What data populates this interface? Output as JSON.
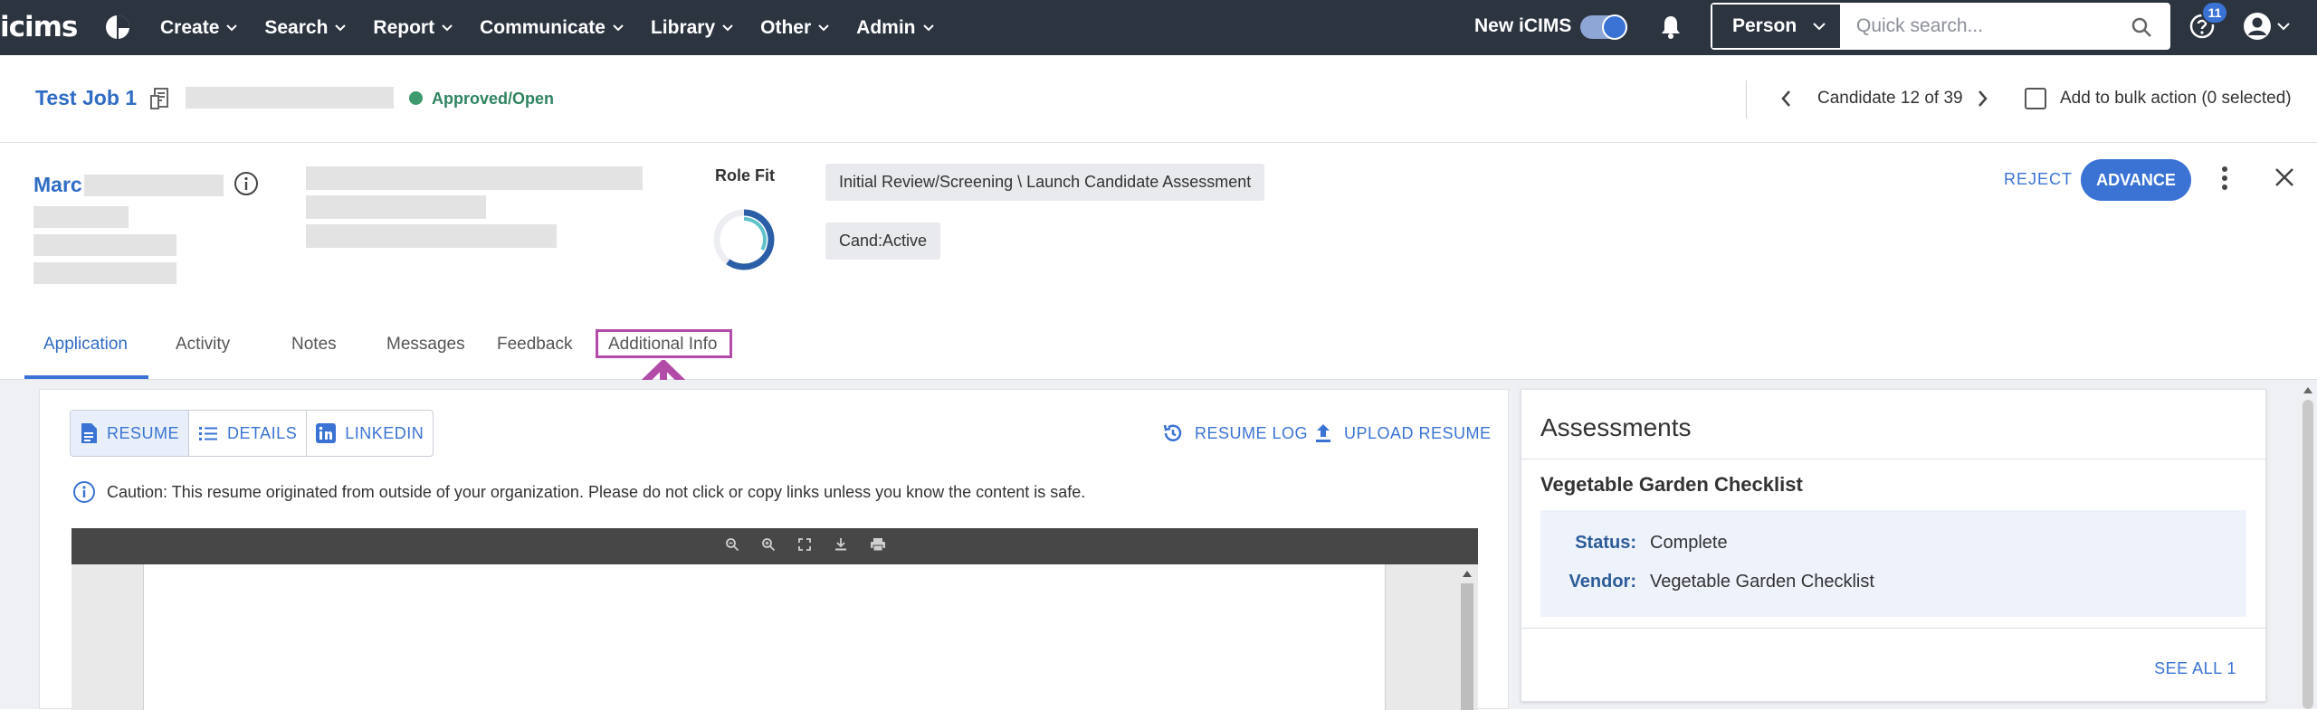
{
  "nav": {
    "logo": "icims",
    "menu": [
      "Create",
      "Search",
      "Report",
      "Communicate",
      "Library",
      "Other",
      "Admin"
    ],
    "new_icims_label": "New iCIMS",
    "search_type": "Person",
    "search_placeholder": "Quick search...",
    "notification_count": "11"
  },
  "job": {
    "title": "Test Job 1",
    "status": "Approved/Open",
    "candidate_position": "Candidate 12 of 39",
    "bulk_action_label": "Add to bulk action (0 selected)"
  },
  "candidate": {
    "first_name": "Marc",
    "role_fit_label": "Role Fit",
    "role_fit_score": 0.6,
    "workflow_status": "Initial Review/Screening \\ Launch Candidate Assessment",
    "cand_status": "Cand:Active",
    "reject_label": "REJECT",
    "advance_label": "ADVANCE"
  },
  "tabs": [
    "Application",
    "Activity",
    "Notes",
    "Messages",
    "Feedback",
    "Additional Info"
  ],
  "active_tab": "Application",
  "resume": {
    "segments": [
      "RESUME",
      "DETAILS",
      "LINKEDIN"
    ],
    "resume_log_label": "RESUME LOG",
    "upload_label": "UPLOAD RESUME",
    "caution_text": "Caution: This resume originated from outside of your organization. Please do not click or copy links unless you know the content is safe."
  },
  "assessments": {
    "title": "Assessments",
    "name": "Vegetable Garden Checklist",
    "status_label": "Status:",
    "status_value": "Complete",
    "vendor_label": "Vendor:",
    "vendor_value": "Vegetable Garden Checklist",
    "see_all_label": "SEE ALL 1"
  },
  "colors": {
    "nav_bg": "#2c3440",
    "accent": "#3a73d4",
    "status_green": "#3d9a6e",
    "annotation": "#b24ca8"
  }
}
